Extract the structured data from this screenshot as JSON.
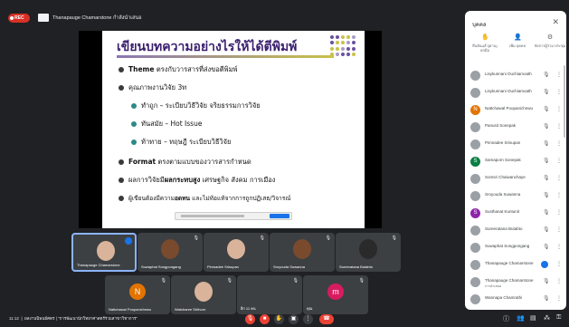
{
  "header": {
    "rec_label": "REC",
    "presenter_title": "Thanapauge Chamarstone กำลังนำเสนอ"
  },
  "slide": {
    "title": "เขียนบทความอย่างไรให้ได้ตีพิมพ์",
    "bullets": [
      {
        "bold": "Theme",
        "text": " ตรงกับวารสารที่ส่งขอตีพิมพ์"
      },
      {
        "bold": "",
        "text": "คุณภาพงานวิจัย 3ท"
      },
      {
        "bold": "",
        "text": "ทำถูก – ระเบียบวิธีวิจัย จริยธรรมการวิจัย"
      },
      {
        "bold": "",
        "text": "ทันสมัย – Hot Issue"
      },
      {
        "bold": "",
        "text": "ท้าทาย – ทฤษฎี ระเบียบวิธีวิจัย"
      },
      {
        "bold": "Format",
        "text": " ตรงตามแบบของวารสารกำหนด"
      },
      {
        "bold": "ผลกระทบสูง",
        "pre": "ผลการวิจัยมี",
        "text": " เศรษฐกิจ สังคม การเมือง"
      },
      {
        "bold": "อดทน",
        "pre": "ผู้เขียนต้องมีความ",
        "text": " และไม่ท้อแท้จากการถูกปฏิเสธ/วิจารณ์"
      }
    ]
  },
  "panel": {
    "title": "บุคคล",
    "controls": [
      "ยืนยันแล้ว(ผ่าน) ยกมือ",
      "เพิ่ม บุคคล",
      "จัดการผู้ร่วม ประชุม"
    ],
    "participants": [
      {
        "name": "Lisykunnani Ouchiamoath",
        "initial": ""
      },
      {
        "name": "Lisykunnani Ouchiamoath",
        "initial": ""
      },
      {
        "name": "Nattchawal Poopanichnwu",
        "initial": "N",
        "color": "#e37400"
      },
      {
        "name": "Panusit Sonepak",
        "initial": ""
      },
      {
        "name": "Pimnadee Srisupan",
        "initial": ""
      },
      {
        "name": "Samaporn Sonepak",
        "initial": "S",
        "color": "#0b8043"
      },
      {
        "name": "Somsri Chaiwanchaye",
        "initial": ""
      },
      {
        "name": "Sroyouda Suwanna",
        "initial": ""
      },
      {
        "name": "Susthanat Kuntunit",
        "initial": "S",
        "color": "#8e24aa"
      },
      {
        "name": "Sureeratana Butabto",
        "initial": ""
      },
      {
        "name": "Suwaphat Songpongang",
        "initial": ""
      },
      {
        "name": "Thanapauge Chamarstone",
        "initial": "",
        "badge": true
      },
      {
        "name": "Thanapauge Chamarstone",
        "initial": "",
        "sub": "การนำเสนอ"
      },
      {
        "name": "Wannapa Chamrathi",
        "initial": ""
      }
    ]
  },
  "tiles": [
    {
      "name": "Thanapauge Chamarstone",
      "active": true
    },
    {
      "name": "Suwaphat Songpongang"
    },
    {
      "name": "Pimnadee Srisupan"
    },
    {
      "name": "Sroyouda Suwanna"
    },
    {
      "name": "Sureeratana Butabto"
    },
    {
      "name": "Nattchawal Poopanichnwu",
      "initial": "N",
      "color": "#e37400"
    },
    {
      "name": "Watcharee Srithorn"
    },
    {
      "name": "อีก 11 คน"
    },
    {
      "name": "คุณ",
      "initial": "m",
      "color": "#d81b60"
    }
  ],
  "footer": {
    "time": "11:12",
    "meeting_title": "ผลงานนิพนธ์ศตร | \"การพัฒนานักวิทยาศาสตร์ร่วมสาขาวิชาการ\""
  }
}
